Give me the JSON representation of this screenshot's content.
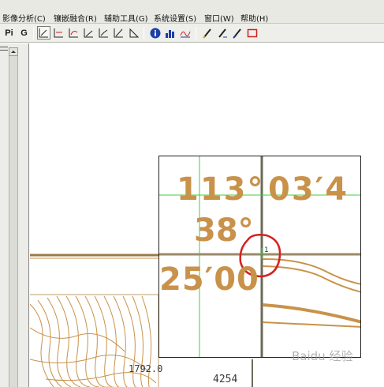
{
  "menu": {
    "items": [
      "影像分析(C)",
      "镶嵌融合(R)",
      "辅助工具(G)",
      "系统设置(S)",
      "窗口(W)",
      "帮助(H)"
    ]
  },
  "toolbar": {
    "pi_label": "Pi",
    "g_label": "G"
  },
  "map": {
    "contour_label": "1792.0",
    "grid_label": "4254"
  },
  "magnifier": {
    "degree_text": "113°",
    "minutes_text": "03′4",
    "latitude_text": "38°",
    "lat_minutes_text": "25′00",
    "point_marker": "1"
  },
  "watermark": {
    "text": "Baidu 经验"
  },
  "colors": {
    "map_ink": "#c9924a",
    "crosshair": "#3ccf3c",
    "annotation_circle": "#d42020",
    "grid_line": "#6b6b5a"
  }
}
